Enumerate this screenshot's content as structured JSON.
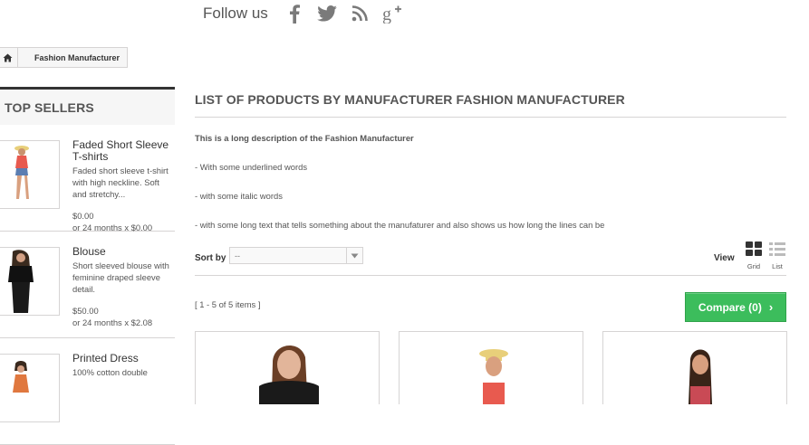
{
  "follow": {
    "label": "Follow us",
    "icons": [
      "facebook-icon",
      "twitter-icon",
      "rss-icon",
      "google-plus-icon"
    ]
  },
  "breadcrumb": {
    "home_icon": "home-icon",
    "current": "Fashion Manufacturer"
  },
  "sidebar": {
    "title": "TOP SELLERS",
    "items": [
      {
        "name": "Faded Short Sleeve T-shirts",
        "description": "Faded short sleeve t-shirt with high neckline. Soft and stretchy...",
        "price": "$0.00",
        "installments": "or 24 months x $0.00"
      },
      {
        "name": "Blouse",
        "description": "Short sleeved blouse with feminine draped sleeve detail.",
        "price": "$50.00",
        "installments": "or 24 months x $2.08"
      },
      {
        "name": "Printed Dress",
        "description": "100% cotton double"
      }
    ]
  },
  "main": {
    "heading": "LIST OF PRODUCTS BY MANUFACTURER FASHION MANUFACTURER",
    "description_title": "This is a long description of the Fashion Manufacturer",
    "description_lines": [
      "- With some underlined words",
      "- with some italic words",
      "- with some long text that tells something about the manufaturer and also shows us how long the lines can be"
    ],
    "sort": {
      "label": "Sort by",
      "selected": "--"
    },
    "view": {
      "label": "View",
      "grid": "Grid",
      "list": "List"
    },
    "count": "[ 1 - 5 of 5 items ]",
    "compare_label": "Compare (0)"
  },
  "colors": {
    "accent_green": "#3cbd5c",
    "border": "#d6d4d4",
    "text": "#333333"
  }
}
